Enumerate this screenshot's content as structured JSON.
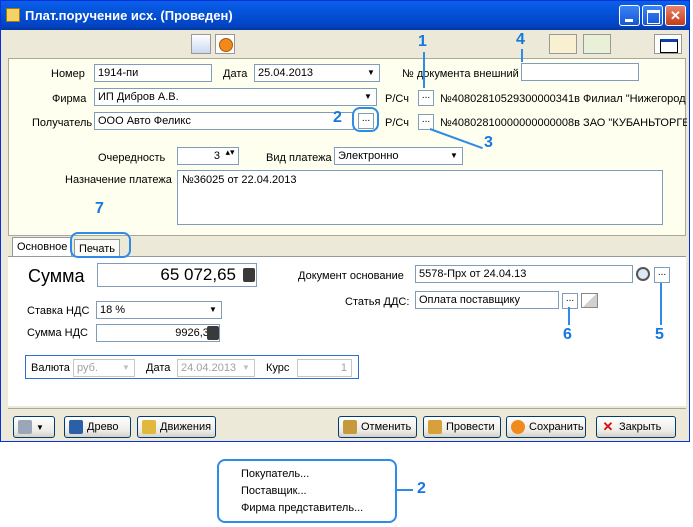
{
  "window": {
    "title": "Плат.поручение исх. (Проведен)"
  },
  "form": {
    "number_label": "Номер",
    "number_value": "1914-пи",
    "date_label": "Дата",
    "date_value": "25.04.2013",
    "ext_doc_label": "№ документа внешний",
    "ext_doc_value": "",
    "firm_label": "Фирма",
    "firm_value": "ИП Дибров А.В.",
    "firm_account_label": "Р/Сч",
    "firm_account_value": "№40802810529300000341в Филиал \"Нижегород",
    "recipient_label": "Получатель",
    "recipient_value": "ООО Авто Феликс",
    "recipient_account_label": "Р/Сч",
    "recipient_account_value": "№40802810000000000008в ЗАО \"КУБАНЬТОРГЕ",
    "priority_label": "Очередность",
    "priority_value": "3",
    "payment_type_label": "Вид платежа",
    "payment_type_value": "Электронно",
    "purpose_label": "Назначение платежа",
    "purpose_value": "№36025 от 22.04.2013",
    "ellipsis": "...",
    "spin": "▴▾"
  },
  "tabs": [
    {
      "label": "Основное"
    },
    {
      "label": "Печать"
    }
  ],
  "main": {
    "sum_label": "Сумма",
    "sum_value": "65 072,65",
    "vat_rate_label": "Ставка НДС",
    "vat_rate_value": "18 %",
    "vat_sum_label": "Сумма НДС",
    "vat_sum_value": "9926,34",
    "base_doc_label": "Документ основание",
    "base_doc_value": "5578-Прх от 24.04.13",
    "dds_label": "Статья ДДС:",
    "dds_value": "Оплата поставщику",
    "currency_label": "Валюта",
    "currency_value": "руб.",
    "cur_date_label": "Дата",
    "cur_date_value": "24.04.2013",
    "rate_label": "Курс",
    "rate_value": "1"
  },
  "buttons": {
    "tree": "Древо",
    "movements": "Движения",
    "cancel": "Отменить",
    "post": "Провести",
    "save": "Сохранить",
    "close": "Закрыть"
  },
  "popup_menu": {
    "items": [
      "Покупатель...",
      "Поставщик...",
      "Фирма представитель..."
    ]
  },
  "callouts": [
    "1",
    "2",
    "3",
    "4",
    "5",
    "6",
    "7",
    "2"
  ],
  "colors": {
    "title_bar": "#0454D8",
    "callout": "#1577E0",
    "window_bg": "#ECE9D8"
  }
}
